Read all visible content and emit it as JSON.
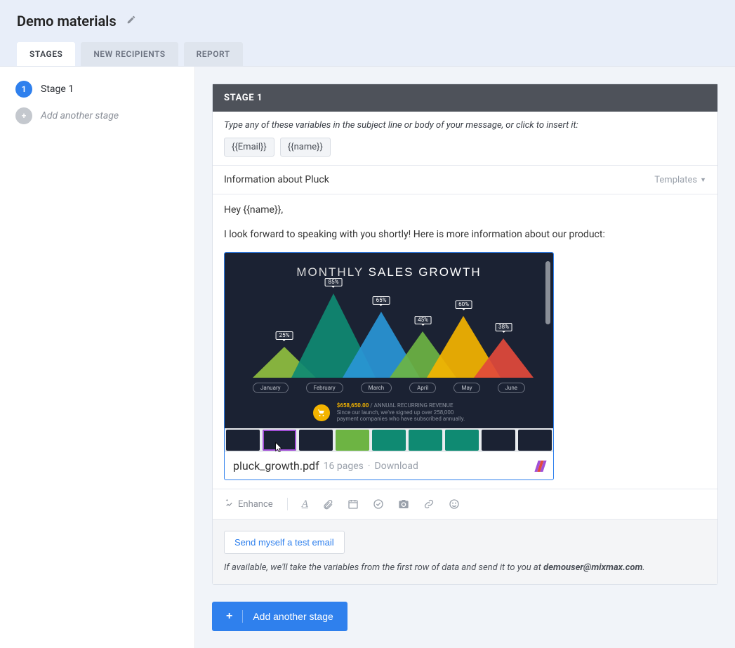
{
  "header": {
    "title": "Demo materials"
  },
  "tabs": [
    {
      "id": "stages",
      "label": "STAGES",
      "active": true
    },
    {
      "id": "new-recipients",
      "label": "NEW RECIPIENTS",
      "active": false
    },
    {
      "id": "report",
      "label": "REPORT",
      "active": false
    }
  ],
  "sidebar": {
    "stages": [
      {
        "number": "1",
        "label": "Stage 1"
      }
    ],
    "add_label": "Add another stage"
  },
  "editor": {
    "card_title": "STAGE 1",
    "variables_hint": "Type any of these variables in the subject line or body of your message, or click to insert it:",
    "variables": [
      "{{Email}}",
      "{{name}}"
    ],
    "subject": "Information about Pluck",
    "templates_label": "Templates",
    "body_greeting": "Hey {{name}},",
    "body_line": "I look forward to speaking with you shortly! Here is more information about our product:"
  },
  "attachment": {
    "filename": "pluck_growth.pdf",
    "pages_label": "16 pages",
    "separator": "·",
    "download_label": "Download",
    "slide_title_light": "MONTHLY",
    "slide_title_bold": "SALES GROWTH",
    "months": [
      "January",
      "February",
      "March",
      "April",
      "May",
      "June"
    ],
    "footer_amount": "$658,650.00",
    "footer_amount_suffix": "/ ANNUAL RECURRING REVENUE",
    "footer_sub1": "Since our launch, we've signed up over 258,000",
    "footer_sub2": "payment companies who have subscribed annually.",
    "thumb_colors": [
      "#1b2233",
      "#1b2233",
      "#1b2233",
      "#6db443",
      "#0f8a72",
      "#0f8a72",
      "#0f8a72",
      "#1b2233",
      "#1b2233"
    ],
    "selected_thumb": 1
  },
  "chart_data": {
    "type": "area",
    "title": "MONTHLY SALES GROWTH",
    "categories": [
      "January",
      "February",
      "March",
      "April",
      "May",
      "June"
    ],
    "series": [
      {
        "name": "January",
        "value": 25,
        "color": "#8fbf3f"
      },
      {
        "name": "February",
        "value": 85,
        "color": "#0f8a72"
      },
      {
        "name": "March",
        "value": 65,
        "color": "#2996d6"
      },
      {
        "name": "April",
        "value": 45,
        "color": "#6db443"
      },
      {
        "name": "May",
        "value": 60,
        "color": "#f4b400"
      },
      {
        "name": "June",
        "value": 38,
        "color": "#e24a3b"
      }
    ],
    "xlabel": "",
    "ylabel": "",
    "ylim": [
      0,
      100
    ]
  },
  "toolbar": {
    "enhance_label": "Enhance"
  },
  "footer": {
    "test_email_label": "Send myself a test email",
    "note_prefix": "If available, we'll take the variables from the first row of data and send it to you at ",
    "note_email": "demouser@mixmax.com",
    "note_suffix": "."
  },
  "add_stage_button": "Add another stage"
}
